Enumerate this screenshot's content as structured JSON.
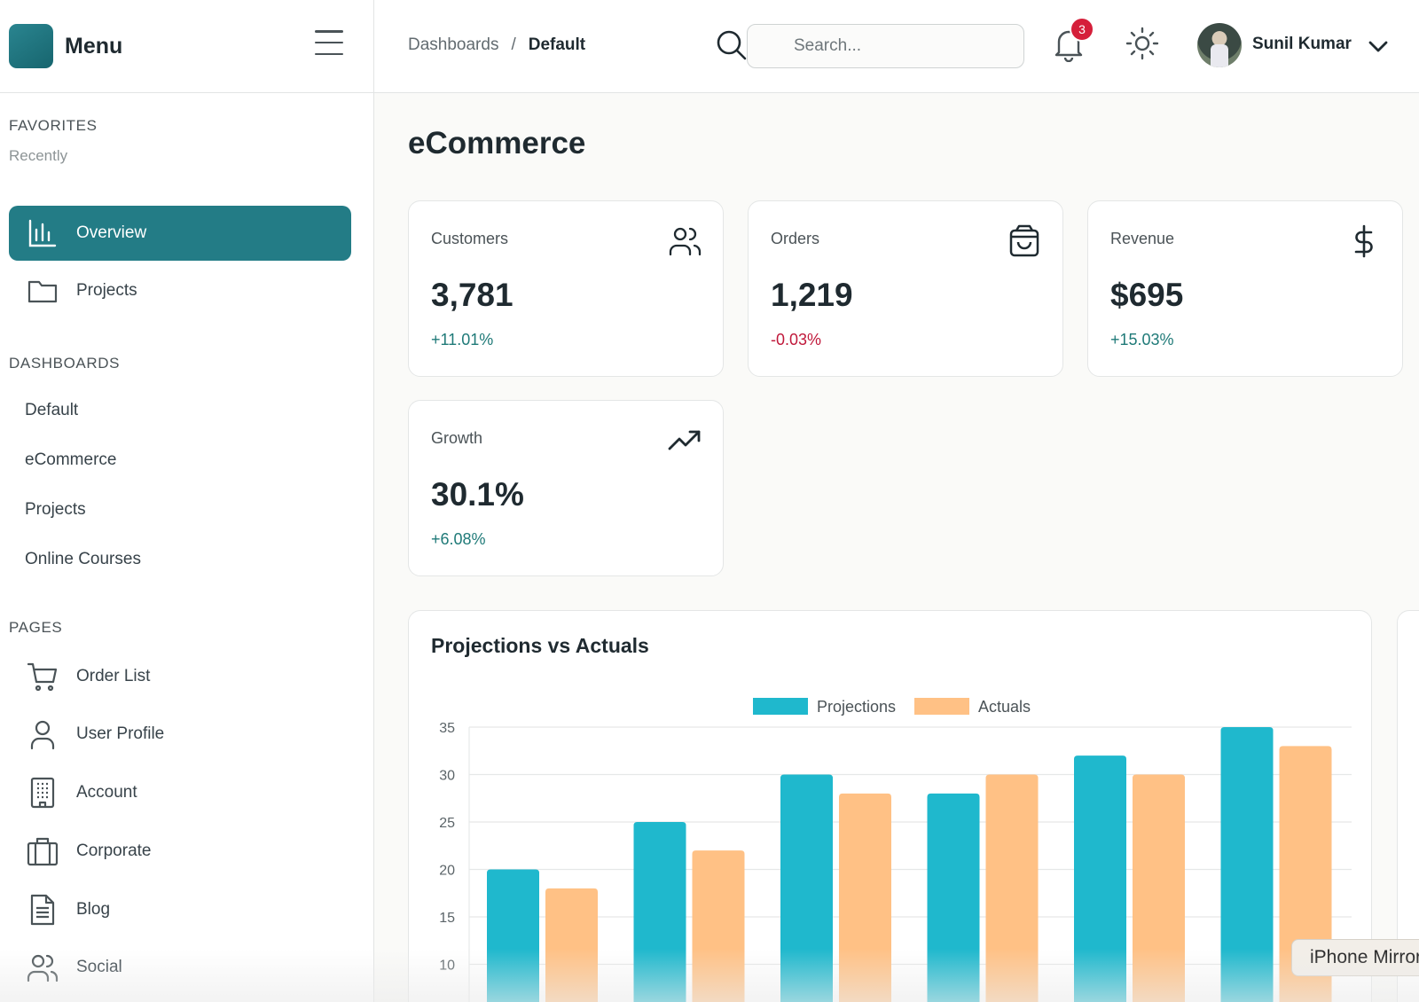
{
  "sidebar": {
    "title": "Menu",
    "favorites_title": "FAVORITES",
    "favorites_sub": "Recently",
    "top_items": [
      {
        "label": "Overview",
        "icon": "bar-chart-icon"
      },
      {
        "label": "Projects",
        "icon": "folder-icon"
      }
    ],
    "dashboards_title": "DASHBOARDS",
    "dashboards": [
      "Default",
      "eCommerce",
      "Projects",
      "Online Courses"
    ],
    "pages_title": "PAGES",
    "pages": [
      {
        "label": "Order List",
        "icon": "cart-icon"
      },
      {
        "label": "User Profile",
        "icon": "user-icon"
      },
      {
        "label": "Account",
        "icon": "building-icon"
      },
      {
        "label": "Corporate",
        "icon": "briefcase-icon"
      },
      {
        "label": "Blog",
        "icon": "document-icon"
      },
      {
        "label": "Social",
        "icon": "users-icon"
      }
    ]
  },
  "header": {
    "breadcrumb": [
      "Dashboards",
      "/",
      "Default"
    ],
    "search_placeholder": "Search...",
    "notification_count": "3",
    "user_name": "Sunil Kumar"
  },
  "main": {
    "title": "eCommerce",
    "cards": [
      {
        "label": "Customers",
        "value": "3,781",
        "change": "+11.01%",
        "trend": "positive",
        "icon": "users-icon"
      },
      {
        "label": "Orders",
        "value": "1,219",
        "change": "-0.03%",
        "trend": "negative",
        "icon": "shopping-bag-icon"
      },
      {
        "label": "Revenue",
        "value": "$695",
        "change": "+15.03%",
        "trend": "positive",
        "icon": "dollar-icon"
      },
      {
        "label": "Growth",
        "value": "30.1%",
        "change": "+6.08%",
        "trend": "positive",
        "icon": "trending-up-icon"
      }
    ]
  },
  "chart_data": {
    "type": "bar",
    "title": "Projections vs Actuals",
    "series": [
      {
        "name": "Projections",
        "color": "#1fb8cd",
        "values": [
          20,
          25,
          30,
          28,
          32,
          35
        ]
      },
      {
        "name": "Actuals",
        "color": "#ffc185",
        "values": [
          18,
          22,
          28,
          30,
          30,
          33
        ]
      }
    ],
    "y_ticks": [
      10,
      15,
      20,
      25,
      30,
      35
    ],
    "ylim": [
      0,
      35
    ],
    "grid": true,
    "legend_position": "top-center"
  },
  "overlay": {
    "tooltip_text": "iPhone Mirroring"
  },
  "colors": {
    "accent": "#237c86",
    "positive": "#1f7a78",
    "negative": "#c0183a",
    "badge": "#d51f3a"
  }
}
